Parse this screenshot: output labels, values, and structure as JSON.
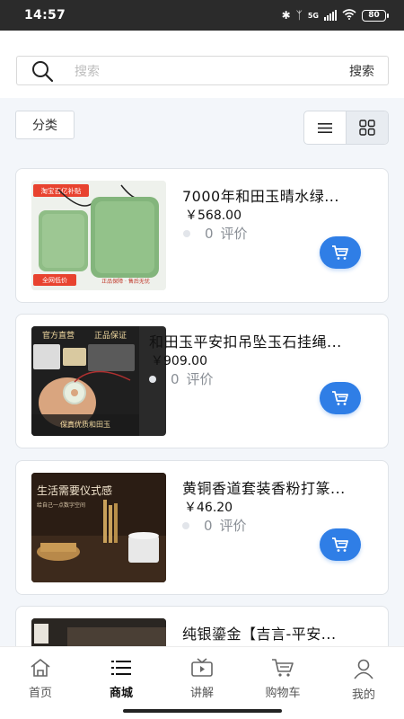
{
  "status_bar": {
    "time": "14:57",
    "network": "5G",
    "battery": "80"
  },
  "search": {
    "placeholder": "搜索",
    "button_label": "搜索"
  },
  "filters": {
    "category_label": "分类",
    "view_mode": "grid"
  },
  "products": [
    {
      "title": "7000年和田玉晴水绿...",
      "price": "￥568.00",
      "review_count": "0",
      "review_label": "评价",
      "image_badges": [
        "淘宝百亿补贴",
        "全网低价",
        "正品保障 · 售后无忧"
      ]
    },
    {
      "title": "和田玉平安扣吊坠玉石挂绳...",
      "price": "￥909.00",
      "review_count": "0",
      "review_label": "评价",
      "image_badges": [
        "官方直营",
        "正品保证",
        "保真优质和田玉"
      ]
    },
    {
      "title": "黄铜香道套装香粉打篆...",
      "price": "￥46.20",
      "review_count": "0",
      "review_label": "评价",
      "image_badges": [
        "生活需要仪式感",
        "给自己一点数字空间"
      ]
    },
    {
      "title": "纯银鎏金【吉言-平安...",
      "price": "",
      "review_count": "",
      "review_label": "",
      "image_badges": []
    }
  ],
  "tabbar": {
    "items": [
      {
        "label": "首页",
        "icon": "home-icon",
        "active": false
      },
      {
        "label": "商城",
        "icon": "list-icon",
        "active": true
      },
      {
        "label": "讲解",
        "icon": "tv-icon",
        "active": false
      },
      {
        "label": "购物车",
        "icon": "cart-icon",
        "active": false
      },
      {
        "label": "我的",
        "icon": "user-icon",
        "active": false
      }
    ]
  },
  "colors": {
    "accent": "#2f7ee6",
    "background": "#f3f6fa",
    "status_bar": "#2b2b2b"
  }
}
